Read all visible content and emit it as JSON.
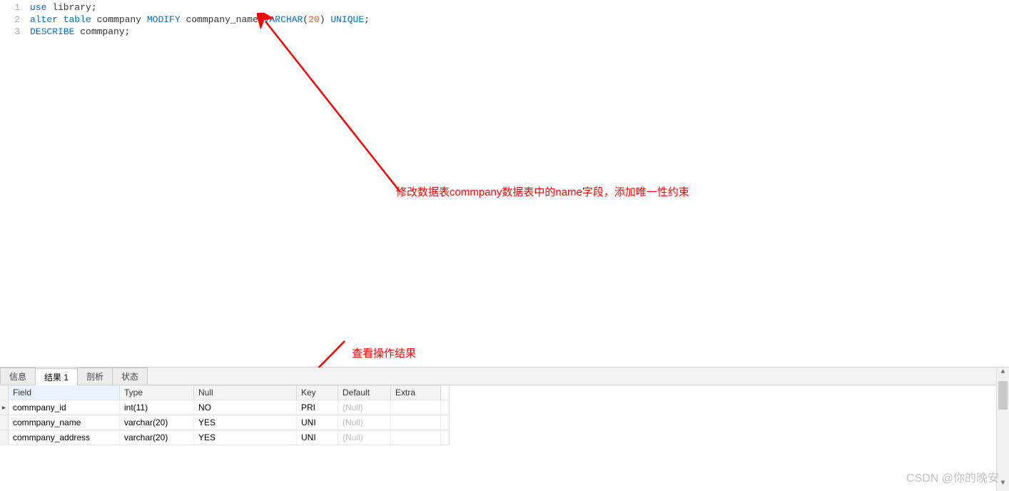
{
  "editor": {
    "lines": [
      {
        "n": "1",
        "tokens": [
          {
            "t": "use",
            "cls": "kw"
          },
          {
            "t": " library;",
            "cls": "plain"
          }
        ]
      },
      {
        "n": "2",
        "tokens": [
          {
            "t": "alter table",
            "cls": "kw"
          },
          {
            "t": " commpany ",
            "cls": "plain"
          },
          {
            "t": "MODIFY",
            "cls": "kw2"
          },
          {
            "t": " commpany_name ",
            "cls": "plain"
          },
          {
            "t": "VARCHAR",
            "cls": "type"
          },
          {
            "t": "(",
            "cls": "plain"
          },
          {
            "t": "20",
            "cls": "num"
          },
          {
            "t": ") ",
            "cls": "plain"
          },
          {
            "t": "UNIQUE",
            "cls": "type"
          },
          {
            "t": ";",
            "cls": "plain"
          }
        ]
      },
      {
        "n": "3",
        "tokens": [
          {
            "t": "DESCRIBE",
            "cls": "kw2"
          },
          {
            "t": " commpany;",
            "cls": "plain"
          }
        ]
      }
    ]
  },
  "annotations": {
    "anno1": "修改数据表commpany数据表中的name字段，添加唯一性约束",
    "anno2": "查看操作结果"
  },
  "tabs": {
    "items": [
      {
        "label": "信息",
        "active": false
      },
      {
        "label": "结果 1",
        "active": true
      },
      {
        "label": "剖析",
        "active": false
      },
      {
        "label": "状态",
        "active": false
      }
    ]
  },
  "grid": {
    "headers": {
      "field": "Field",
      "type": "Type",
      "null": "Null",
      "key": "Key",
      "default": "Default",
      "extra": "Extra"
    },
    "rows": [
      {
        "marker": "▸",
        "field": "commpany_id",
        "type": "int(11)",
        "null": "NO",
        "key": "PRI",
        "default": "(Null)",
        "extra": ""
      },
      {
        "marker": "",
        "field": "commpany_name",
        "type": "varchar(20)",
        "null": "YES",
        "key": "UNI",
        "default": "(Null)",
        "extra": ""
      },
      {
        "marker": "",
        "field": "commpany_address",
        "type": "varchar(20)",
        "null": "YES",
        "key": "UNI",
        "default": "(Null)",
        "extra": ""
      }
    ]
  },
  "watermark": "CSDN @你的晚安"
}
